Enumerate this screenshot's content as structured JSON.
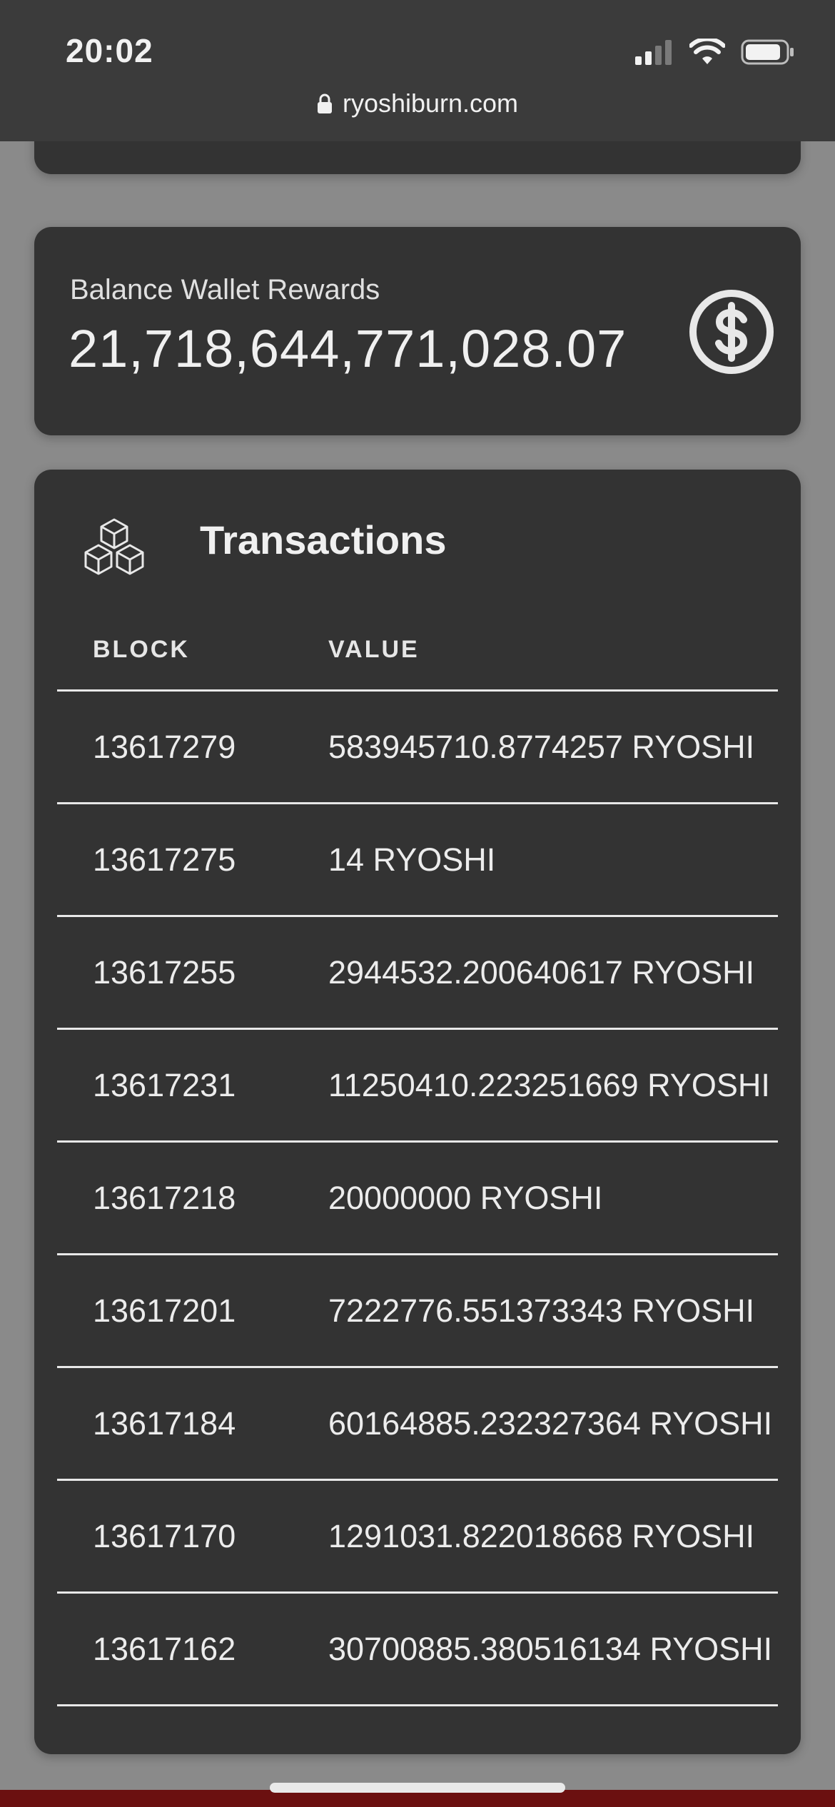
{
  "status_bar": {
    "time": "20:02",
    "url": "ryoshiburn.com"
  },
  "balance": {
    "label": "Balance Wallet Rewards",
    "value": "21,718,644,771,028.07"
  },
  "transactions": {
    "title": "Transactions",
    "columns": {
      "block": "BLOCK",
      "value": "VALUE"
    },
    "rows": [
      {
        "block": "13617279",
        "value": "583945710.8774257 RYOSHI"
      },
      {
        "block": "13617275",
        "value": "14 RYOSHI"
      },
      {
        "block": "13617255",
        "value": "2944532.200640617 RYOSHI"
      },
      {
        "block": "13617231",
        "value": "11250410.223251669 RYOSHI"
      },
      {
        "block": "13617218",
        "value": "20000000 RYOSHI"
      },
      {
        "block": "13617201",
        "value": "7222776.551373343 RYOSHI"
      },
      {
        "block": "13617184",
        "value": "60164885.232327364 RYOSHI"
      },
      {
        "block": "13617170",
        "value": "1291031.822018668 RYOSHI"
      },
      {
        "block": "13617162",
        "value": "30700885.380516134 RYOSHI"
      }
    ]
  }
}
